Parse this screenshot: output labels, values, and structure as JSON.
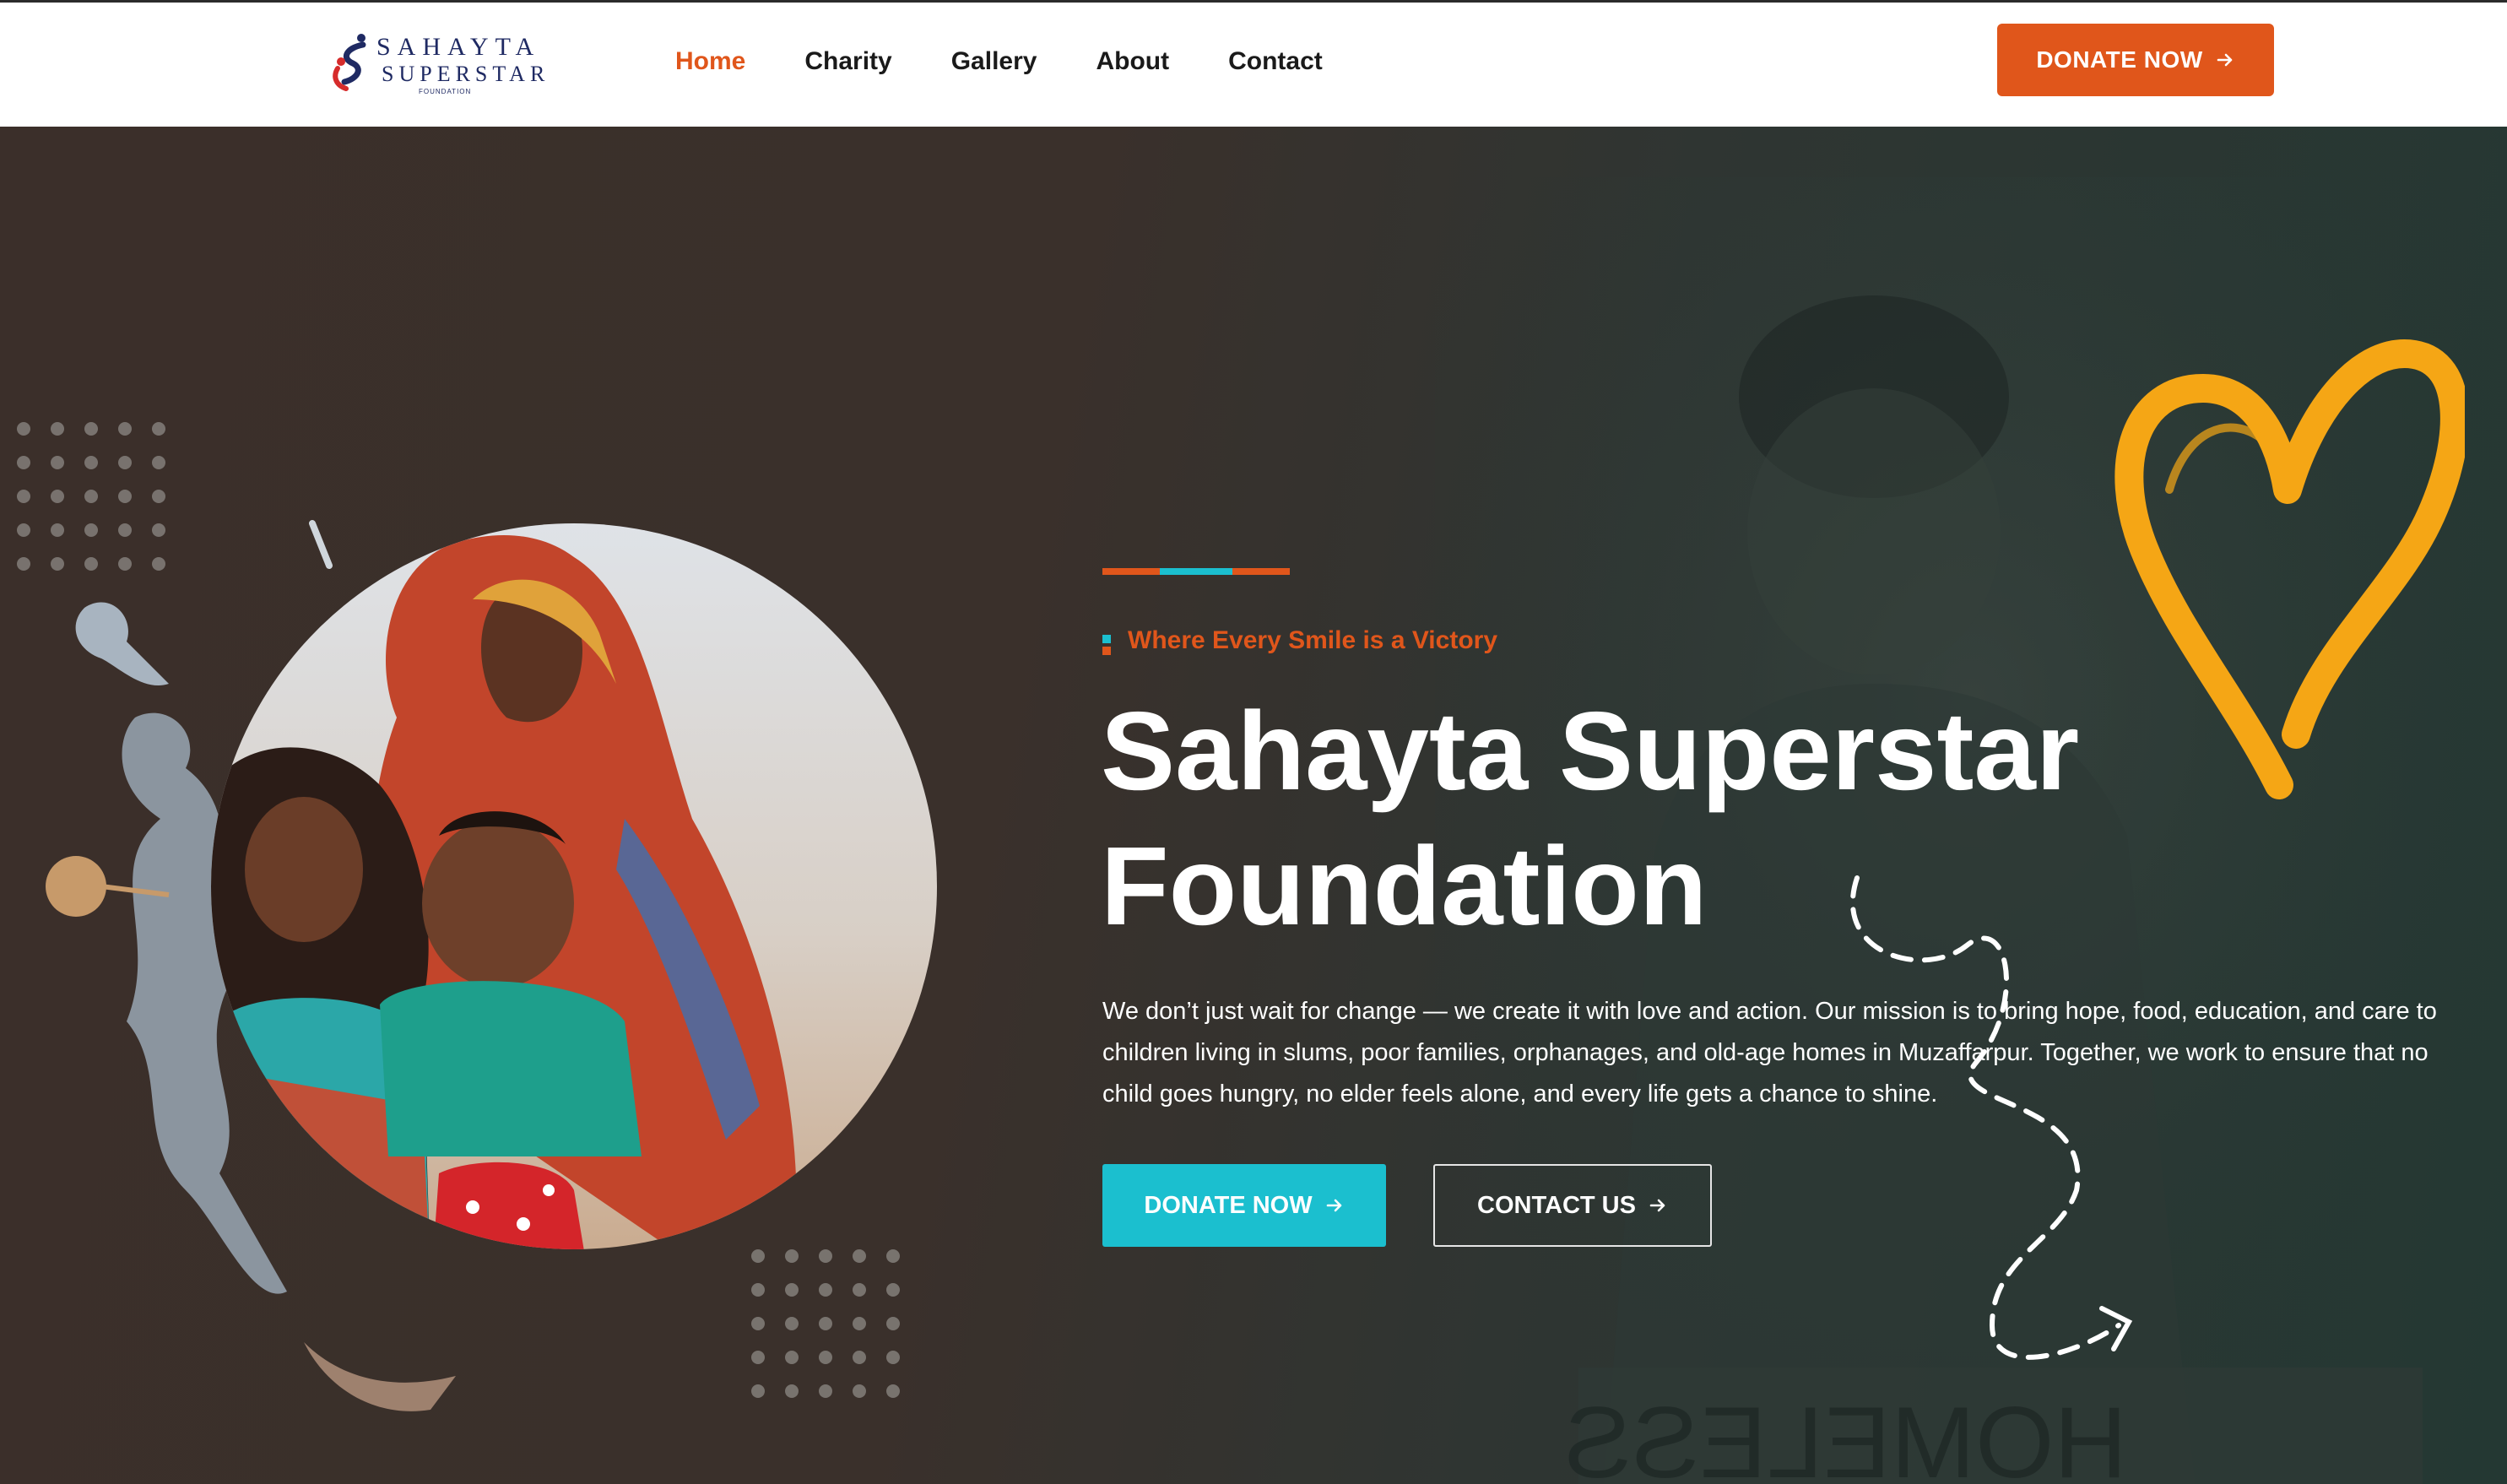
{
  "header": {
    "logo": {
      "line1": "SAHAYTA",
      "line2": "SUPERSTAR",
      "line3": "FOUNDATION"
    },
    "nav": [
      {
        "label": "Home"
      },
      {
        "label": "Charity"
      },
      {
        "label": "Gallery"
      },
      {
        "label": "About"
      },
      {
        "label": "Contact"
      }
    ],
    "donate_label": "DONATE NOW"
  },
  "hero": {
    "tagline": "Where Every Smile is a Victory",
    "title": "Sahayta Superstar Foundation",
    "description": "We don’t just wait for change — we create it with love and action. Our mission is to bring hope, food, education, and care to children living in slums, poor families, orphanages, and old-age homes in Muzaffarpur. Together, we work to ensure that no child goes hungry, no elder feels alone, and every life gets a chance to shine.",
    "donate_label": "DONATE NOW",
    "contact_label": "CONTACT US"
  },
  "icons": {
    "arrow": "arrow-right-icon",
    "heart": "heart-icon"
  },
  "colors": {
    "accent": "#e0561b",
    "teal": "#1bbfcf",
    "heart": "#f5a615",
    "nav_active": "#e0561b"
  }
}
